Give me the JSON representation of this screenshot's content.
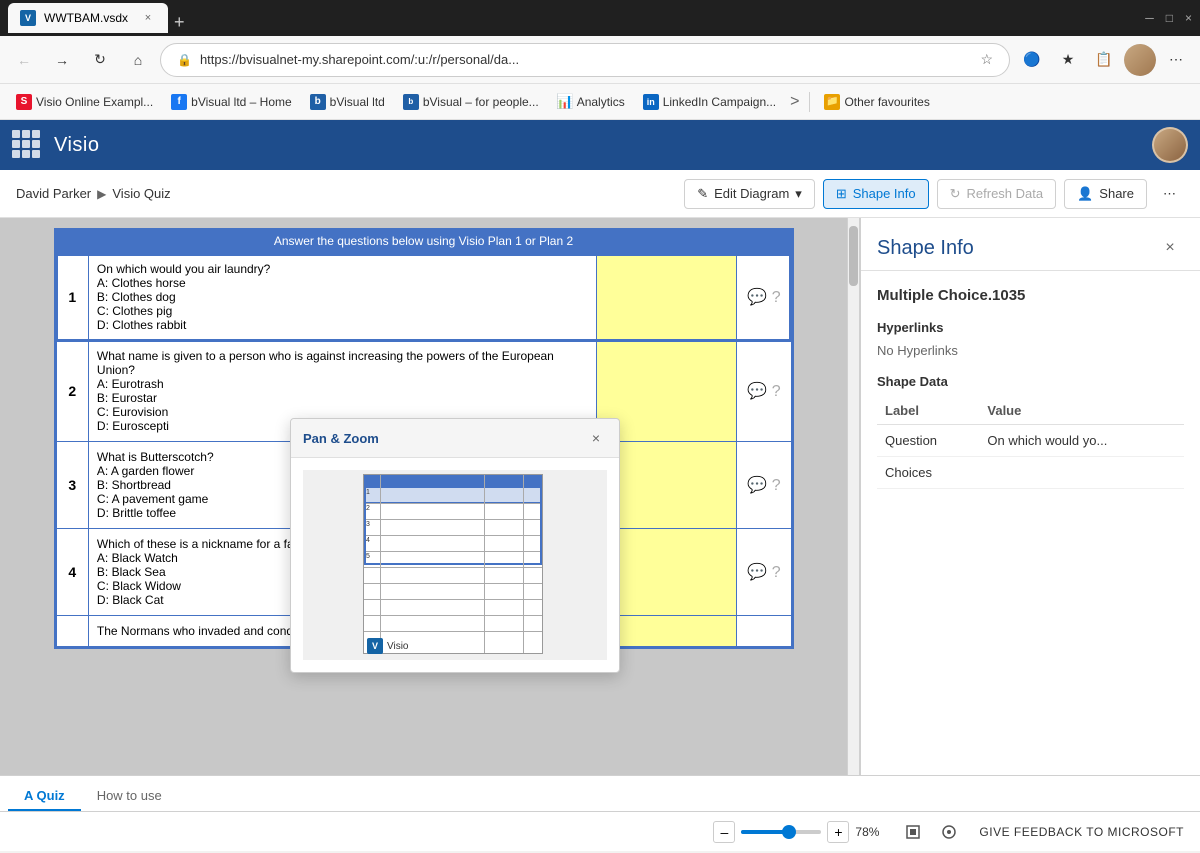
{
  "browser": {
    "tab": {
      "label": "WWTBAM.vsdx",
      "close": "×",
      "new_tab": "+"
    },
    "window_controls": {
      "minimize": "─",
      "maximize": "□",
      "close": "×"
    },
    "navbar": {
      "back": "←",
      "forward": "→",
      "refresh": "↻",
      "home": "⌂",
      "url": "https://bvisualnet-my.sharepoint.com/:u:/r/personal/da...",
      "star": "☆",
      "more": "⋯"
    },
    "bookmarks": [
      {
        "id": "visio-online",
        "label": "Visio Online Exampl...",
        "type": "s"
      },
      {
        "id": "bvisual-home",
        "label": "bVisual ltd – Home",
        "type": "f"
      },
      {
        "id": "bvisual-ltd",
        "label": "bVisual ltd",
        "type": "b"
      },
      {
        "id": "bvisual-people",
        "label": "bVisual – for people...",
        "type": "bv"
      },
      {
        "id": "analytics",
        "label": "Analytics",
        "type": "analytics"
      },
      {
        "id": "linkedin",
        "label": "LinkedIn Campaign...",
        "type": "li"
      },
      {
        "id": "other-favourites",
        "label": "Other favourites",
        "type": "other"
      }
    ],
    "bookmarks_more": ">"
  },
  "app": {
    "title": "Visio",
    "grid_icon": "apps"
  },
  "breadcrumb": {
    "items": [
      "David Parker",
      "Visio Quiz"
    ],
    "separator": "▶"
  },
  "toolbar": {
    "edit_diagram": "Edit Diagram",
    "edit_icon": "✎",
    "shape_info": "Shape Info",
    "shape_info_icon": "⊞",
    "refresh_data": "Refresh Data",
    "refresh_icon": "↻",
    "share": "Share",
    "share_icon": "👤",
    "more": "⋯"
  },
  "diagram": {
    "header": "Answer the questions below using Visio Plan 1 or Plan 2",
    "selected_shape": "Multiple Choice.1035",
    "rows": [
      {
        "num": "1",
        "question": "On which would you air laundry?\nA: Clothes horse\nB: Clothes dog\nC: Clothes pig\nD: Clothes rabbit",
        "selected": true
      },
      {
        "num": "2",
        "question": "What name is given to a person who is against increasing the powers of the European Union?\nA: Eurotrash\nB: Eurostar\nC: Eurovision\nD: Euroscepti"
      },
      {
        "num": "3",
        "question": "What is Butterscotch?\nA: A garden flower\nB: Shortbread\nC: A pavement game\nD: Brittle toffee"
      },
      {
        "num": "4",
        "question": "Which of these is a nickname for a famo...\nA: Black Watch\nB: Black Sea\nC: Black Widow\nD: Black Cat"
      },
      {
        "num": "5",
        "question": "The Normans who invaded and conquered England in 1066 spoke which..."
      }
    ]
  },
  "shape_info": {
    "title": "Shape Info",
    "close": "×",
    "shape_name": "Multiple Choice.1035",
    "hyperlinks_title": "Hyperlinks",
    "hyperlinks_value": "No Hyperlinks",
    "shape_data_title": "Shape Data",
    "columns": {
      "label": "Label",
      "value": "Value"
    },
    "rows": [
      {
        "label": "Question",
        "value": "On which would yo..."
      },
      {
        "label": "Choices",
        "value": ""
      }
    ]
  },
  "pan_zoom": {
    "title": "Pan & Zoom",
    "close": "×"
  },
  "bottom_tabs": [
    {
      "label": "A Quiz",
      "active": true
    },
    {
      "label": "How to use",
      "active": false
    }
  ],
  "status_bar": {
    "zoom_minus": "–",
    "zoom_plus": "+",
    "zoom_level": "78%",
    "feedback": "GIVE FEEDBACK TO MICROSOFT"
  }
}
